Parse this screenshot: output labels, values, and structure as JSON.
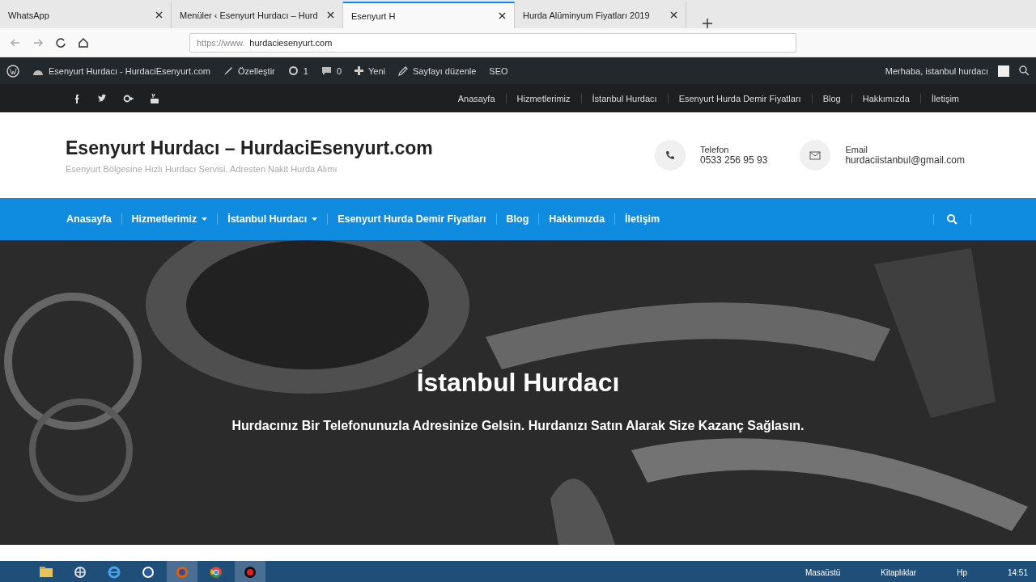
{
  "browser": {
    "tabs": [
      {
        "label": "WhatsApp",
        "selected": false
      },
      {
        "label": "Menüler ‹ Esenyurt Hurdacı – Hurd",
        "selected": false
      },
      {
        "label": "Esenyurt H",
        "selected": true
      },
      {
        "label": "Hurda Alüminyum Fiyatları 2019",
        "selected": false
      }
    ],
    "url_prefix": "https://www.",
    "url_domain": "hurdaciesenyurt.com"
  },
  "admin_bar": {
    "items": [
      {
        "kind": "site",
        "label": "Esenyurt Hurdacı - HurdaciEsenyurt.com"
      },
      {
        "kind": "customize",
        "label": "Özelleştir"
      },
      {
        "kind": "updates",
        "label": "1"
      },
      {
        "kind": "comments",
        "label": "0"
      },
      {
        "kind": "new",
        "label": "Yeni"
      },
      {
        "kind": "edit",
        "label": "Sayfayı düzenle"
      },
      {
        "kind": "plain",
        "label": "SEO"
      }
    ],
    "greeting": "Merhaba, istanbul hurdacı"
  },
  "top_bar": {
    "social": [
      {
        "kind": "facebook"
      },
      {
        "kind": "twitter"
      },
      {
        "kind": "google-plus"
      },
      {
        "kind": "youtube"
      }
    ],
    "links": [
      "Anasayfa",
      "Hizmetlerimiz",
      "İstanbul Hurdacı",
      "Esenyurt Hurda Demir Fiyatları",
      "Blog",
      "Hakkımızda",
      "İletişim"
    ]
  },
  "header": {
    "site_title": "Esenyurt Hurdacı – HurdaciEsenyurt.com",
    "tagline": "Esenyurt Bölgesine Hızlı Hurdacı Servisi. Adresten Nakit Hurda Alımı",
    "contacts": [
      {
        "kind": "phone",
        "label": "Telefon",
        "value": "0533 256 95 93"
      },
      {
        "kind": "email",
        "label": "Email",
        "value": "hurdaciistanbul@gmail.com"
      }
    ]
  },
  "nav": [
    {
      "label": "Anasayfa",
      "dropdown": false
    },
    {
      "label": "Hizmetlerimiz",
      "dropdown": true
    },
    {
      "label": "İstanbul Hurdacı",
      "dropdown": true
    },
    {
      "label": "Esenyurt Hurda Demir Fiyatları",
      "dropdown": false
    },
    {
      "label": "Blog",
      "dropdown": false
    },
    {
      "label": "Hakkımızda",
      "dropdown": false
    },
    {
      "label": "İletişim",
      "dropdown": false
    }
  ],
  "hero": {
    "kind": "picture",
    "title": "İstanbul Hurdacı",
    "subtitle": "Hurdacınız Bir Telefonunuzla Adresinize Gelsin. Hurdanızı Satın Alarak Size Kazanç Sağlasın."
  },
  "taskbar": {
    "apps": [
      {
        "kind": "explorer",
        "active": false
      },
      {
        "kind": "network",
        "active": false
      },
      {
        "kind": "ie",
        "active": false
      },
      {
        "kind": "hp",
        "active": false
      },
      {
        "kind": "firefox",
        "active": true
      },
      {
        "kind": "chrome",
        "active": false
      },
      {
        "kind": "record",
        "active": true
      }
    ],
    "toolbars": [
      "Masaüstü",
      "Kitaplıklar",
      "Hp"
    ],
    "time": "14:51"
  }
}
